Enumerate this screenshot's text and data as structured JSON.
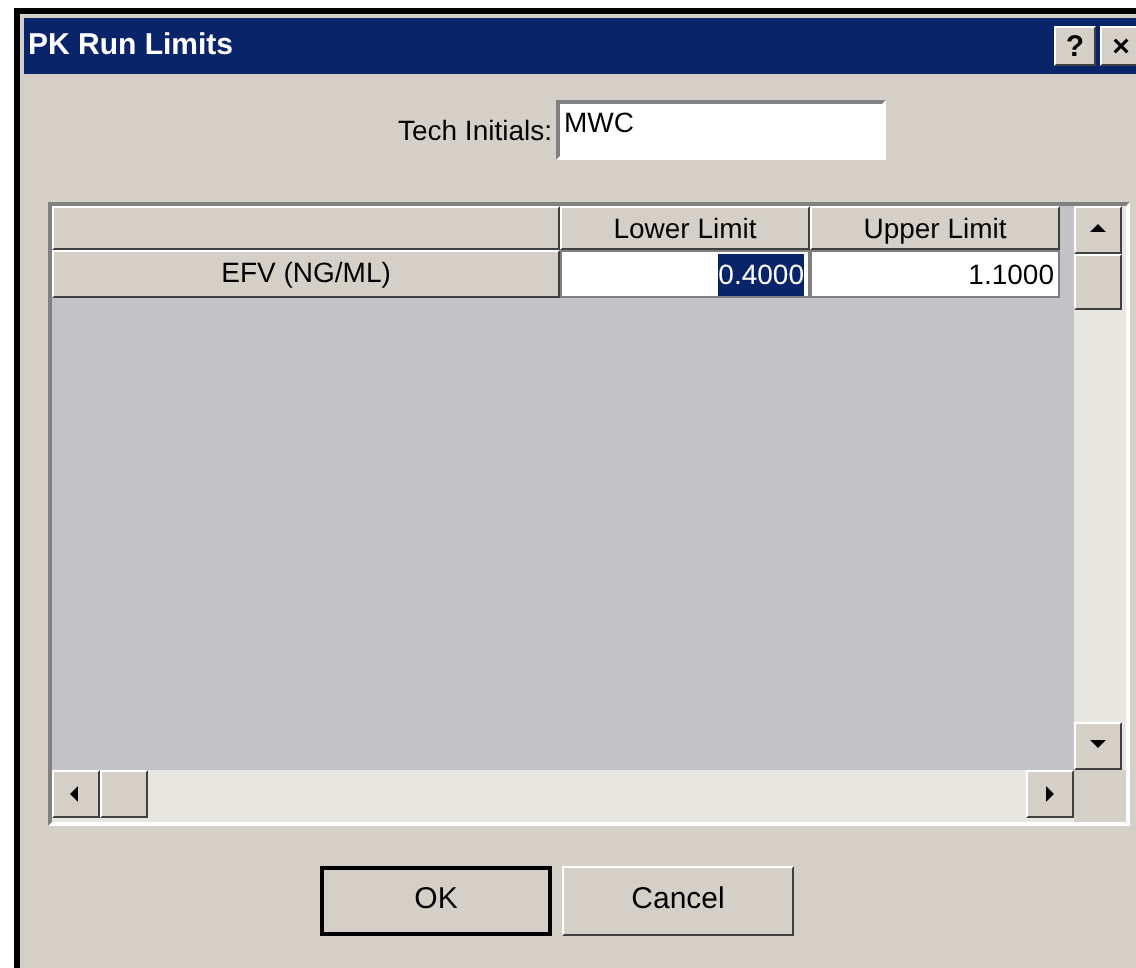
{
  "window": {
    "title": "PK Run Limits",
    "title_buttons": [
      "?",
      "×"
    ]
  },
  "tech_initials": {
    "label": "Tech Initials:",
    "value": "MWC"
  },
  "table": {
    "columns": [
      "Lower Limit",
      "Upper Limit"
    ],
    "rows": [
      {
        "label": "EFV (NG/ML)",
        "cells": [
          {
            "value": "0.4000",
            "selected": true
          },
          {
            "value": "1.1000",
            "selected": false
          }
        ]
      }
    ]
  },
  "buttons": [
    {
      "label": "OK",
      "default": true
    },
    {
      "label": "Cancel",
      "default": false
    }
  ]
}
